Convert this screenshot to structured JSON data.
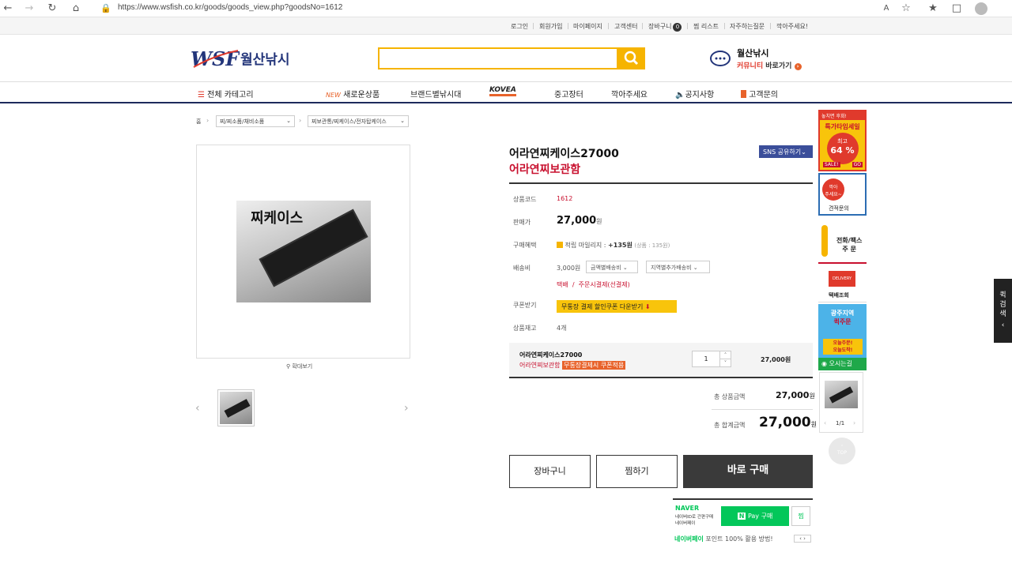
{
  "browser": {
    "url": "https://www.wsfish.co.kr/goods/goods_view.php?goodsNo=1612"
  },
  "util_links": [
    "로그인",
    "회원가입",
    "마이페이지",
    "고객센터",
    "장바구니",
    "찜 리스트",
    "자주하는질문",
    "깍아주세요!"
  ],
  "cart_count": "0",
  "logo": {
    "text": "월산낚시",
    "mark": "WSF"
  },
  "community": {
    "title": "월산낚시",
    "link_a": "커뮤니티",
    "link_b": "바로가기"
  },
  "nav": {
    "all": "전체 카테고리",
    "new_badge": "NEW",
    "new_items": "새로운상품",
    "brand": "브랜드별낚시대",
    "kovea": "KOVEA",
    "used": "중고장터",
    "haggle": "깍아주세요",
    "notice": "공지사항",
    "qna": "고객문의"
  },
  "breadcrumb": {
    "home": "홈",
    "cat1": "찌/찌소품/채비소품",
    "cat2": "찌보관통/찌케이스/전자탑케이스"
  },
  "gallery": {
    "zoom": "확대보기",
    "image_text": "찌케이스"
  },
  "product": {
    "name": "어라연찌케이스27000",
    "subtitle": "어라연찌보관함",
    "sns": "SNS 공유하기",
    "code_label": "상품코드",
    "code": "1612",
    "price_label": "판매가",
    "price": "27,000",
    "won": "원",
    "benefit_label": "구매혜택",
    "benefit": "적립 마일리지 :",
    "benefit_amount": "+135원",
    "benefit_note": "(상품 : 135원)",
    "ship_label": "배송비",
    "ship_cost": "3,000원",
    "ship_opt1": "금액별배송비",
    "ship_opt2": "지역별추가배송비",
    "ship_method": "택배",
    "ship_sep": "/",
    "ship_pay": "주문시결제(선결제)",
    "coupon_label": "쿠폰받기",
    "coupon_btn": "무통장 결제 할인쿠폰 다운받기",
    "stock_label": "상품재고",
    "stock": "4개"
  },
  "option": {
    "name": "어라연찌케이스27000",
    "sub": "어라연찌보관함",
    "tag": "무통장결제시 쿠폰적용",
    "qty": "1",
    "price": "27,000원"
  },
  "totals": {
    "goods_label": "총 상품금액",
    "goods": "27,000",
    "won": "원",
    "sum_label": "총 합계금액",
    "sum": "27,000"
  },
  "buttons": {
    "cart": "장바구니",
    "wish": "찜하기",
    "buy": "바로 구매"
  },
  "npay": {
    "naver": "NAVER",
    "desc_a": "네이버ID로 간편구매",
    "desc_b": "네이버페이",
    "pay": "Pay 구매",
    "wish": "찜",
    "footer_brand": "네이버페이",
    "footer_text": "포인트 100% 활용 방법!"
  },
  "sidebar": {
    "b1_top": "놓치면 후회!",
    "b1_title": "특가타임세일",
    "b1_max": "최고",
    "b1_pct": "64 %",
    "b1_sale": "SALE!",
    "b1_go": "GO",
    "b2_a": "깍아",
    "b2_b": "주세요~",
    "b2_c": "견적문의",
    "b3_a": "전화/팩스",
    "b3_b": "주 문",
    "b4_badge": "DELIVERY",
    "b4_text": "택배조회",
    "b5_a": "광주지역",
    "b5_b": "퀵주문",
    "b5_c": "오늘주문!",
    "b5_d": "오늘도착!",
    "b6_text": "오시는길",
    "recent_page": "1/1",
    "top": "TOP"
  },
  "quick": {
    "label": "퀵검색"
  }
}
